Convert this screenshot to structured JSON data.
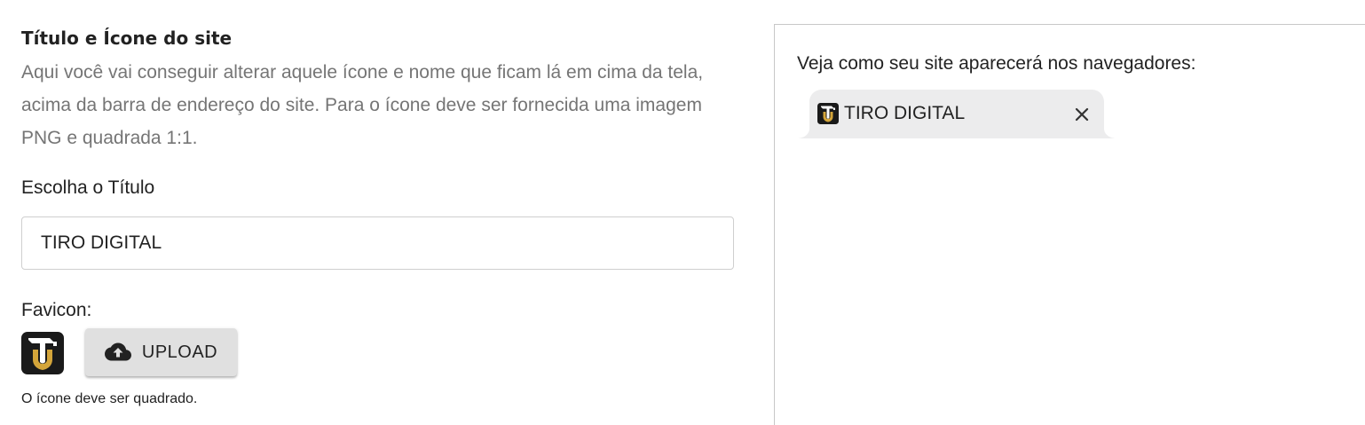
{
  "settings": {
    "section_title": "Título e Ícone do site",
    "section_description": "Aqui você vai conseguir alterar aquele ícone e nome que ficam lá em cima da tela, acima da barra de endereço do site. Para o ícone deve ser fornecida uma imagem PNG e quadrada 1:1.",
    "title_field_label": "Escolha o Título",
    "title_field_value": "TIRO DIGITAL",
    "favicon_label": "Favicon:",
    "upload_button_label": "UPLOAD",
    "favicon_helper_text": "O ícone deve ser quadrado."
  },
  "preview": {
    "caption": "Veja como seu site aparecerá nos navegadores:",
    "tab_title": "TIRO DIGITAL",
    "tab_close_icon": "close-icon"
  },
  "icons": {
    "upload": "cloud-upload-icon",
    "favicon": "tiro-digital-logo-icon"
  },
  "colors": {
    "favicon_background": "#1a1a1a",
    "favicon_gold": "#d4a53a",
    "tab_background": "#ececed",
    "upload_button_background": "#e0e0e0",
    "description_text": "#757575"
  }
}
